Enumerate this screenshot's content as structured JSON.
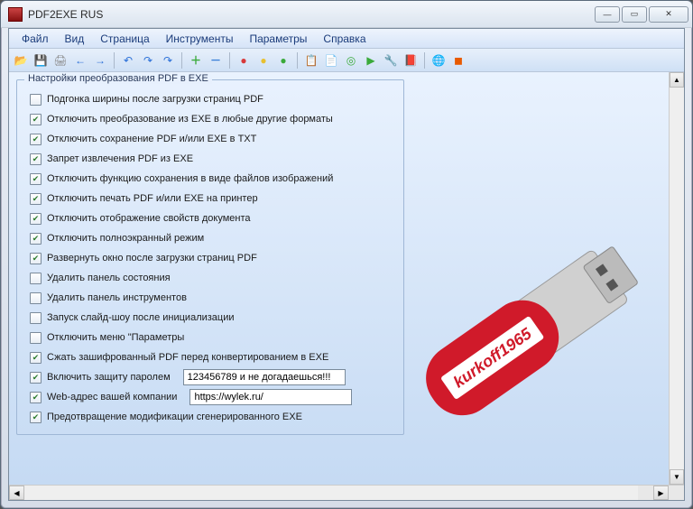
{
  "window": {
    "title": "PDF2EXE RUS"
  },
  "menu": {
    "file": "Файл",
    "view": "Вид",
    "page": "Страница",
    "tools": "Инструменты",
    "params": "Параметры",
    "help": "Справка"
  },
  "toolbar": {
    "open": "📂",
    "save": "💾",
    "print": "🖨",
    "back": "←",
    "fwd": "→",
    "sep": "|",
    "undo": "↶",
    "redo1": "↷",
    "redo2": "↷",
    "plus": "＋",
    "minus": "－",
    "red": "●",
    "yellow": "●",
    "green": "●",
    "copy": "📋",
    "doc": "📄",
    "target": "◎",
    "next": "▶",
    "wrench": "🔧",
    "book": "📕",
    "globe": "🌐",
    "stop": "◼"
  },
  "group": {
    "title": "Настройки преобразования PDF в EXE"
  },
  "options": [
    {
      "checked": false,
      "label": "Подгонка ширины после загрузки страниц PDF"
    },
    {
      "checked": true,
      "label": "Отключить преобразование из EXE в любые другие форматы"
    },
    {
      "checked": true,
      "label": "Отключить сохранение PDF и/или EXE в TXT"
    },
    {
      "checked": true,
      "label": "Запрет извлечения PDF из EXE"
    },
    {
      "checked": true,
      "label": "Отключить функцию сохранения в виде файлов изображений"
    },
    {
      "checked": true,
      "label": "Отключить печать PDF и/или EXE на принтер"
    },
    {
      "checked": true,
      "label": "Отключить отображение свойств документа"
    },
    {
      "checked": true,
      "label": "Отключить полноэкранный режим"
    },
    {
      "checked": true,
      "label": "Развернуть окно после загрузки страниц PDF"
    },
    {
      "checked": false,
      "label": "Удалить панель состояния"
    },
    {
      "checked": false,
      "label": "Удалить панель инструментов"
    },
    {
      "checked": false,
      "label": "Запуск слайд-шоу после инициализации"
    },
    {
      "checked": false,
      "label": "Отключить меню \"Параметры"
    },
    {
      "checked": true,
      "label": "Сжать зашифрованный PDF перед конвертированием в EXE"
    },
    {
      "checked": true,
      "label": "Включить защиту паролем",
      "input": "123456789 и не догадаешься!!!"
    },
    {
      "checked": true,
      "label": "Web-адрес вашей компании",
      "input": "https://wylek.ru/"
    },
    {
      "checked": true,
      "label": "Предотвращение модификации сгенерированного EXE"
    }
  ],
  "usb": {
    "brand": "kurkoff1965"
  }
}
